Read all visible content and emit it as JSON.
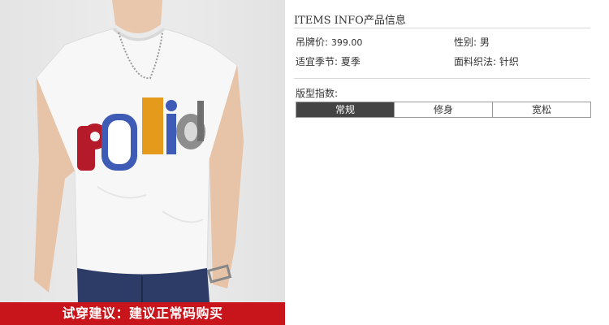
{
  "advice": {
    "text": "试穿建议：建议正常码购买"
  },
  "info": {
    "title_en": "ITEMS INFO",
    "title_cn": "产品信息",
    "price_label": "吊牌价:",
    "price_value": "399.00",
    "gender_label": "性别:",
    "gender_value": "男",
    "season_label": "适宜季节:",
    "season_value": "夏季",
    "fabric_label": "面料织法:",
    "fabric_value": "针织",
    "fit_label": "版型指数:"
  },
  "fit_tabs": [
    {
      "label": "常规",
      "active": true
    },
    {
      "label": "修身",
      "active": false
    },
    {
      "label": "宽松",
      "active": false
    }
  ],
  "colors": {
    "accent_red": "#c8141b",
    "active_tab": "#444444"
  }
}
